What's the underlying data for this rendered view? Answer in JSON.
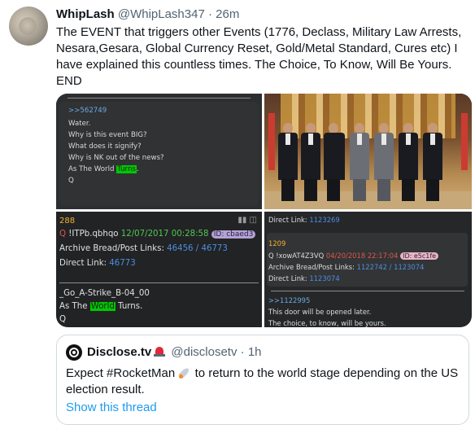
{
  "tweet": {
    "author_name": "WhipLash",
    "author_handle": "@WhipLash347",
    "separator": "·",
    "time": "26m",
    "text_lines": [
      "The EVENT that triggers other Events (1776, Declass, Military Law Arrests,",
      "Nesara,Gesara, Global Currency Reset, Gold/Metal Standard, Cures etc) I",
      "have explained this countless times. The Choice, To Know, Will Be Yours.",
      "END"
    ]
  },
  "media": {
    "panel1": {
      "ref": ">>562749",
      "lines": [
        "Water.",
        "Why is this event BIG?",
        "What does it signify?",
        "Why is NK out of the news?"
      ],
      "last_prefix": "As The World ",
      "last_highlight": "Turns",
      "last_suffix": ".",
      "sign": "Q"
    },
    "panel3": {
      "number": "288",
      "q": "Q",
      "trip": "!ITPb.qbhqo",
      "date": "12/07/2017 00:28:58",
      "id": "ID: cbaed3",
      "archive_label": "Archive Bread/Post Links:",
      "archive_link1": "46456",
      "archive_slash": "/",
      "archive_link2": "46773",
      "direct_label": "Direct Link:",
      "direct_link": "46773",
      "strike": "_Go_A-Strike_B-04_00",
      "as_the": "As The",
      "world": "World",
      "turns": "Turns.",
      "sign": "Q"
    },
    "panel4": {
      "top_label": "Direct Link:",
      "top_link": "1123269",
      "number": "1209",
      "q": "Q",
      "trip": "!xowAT4Z3VQ",
      "date": "04/20/2018 22:17:04",
      "id": "ID: e5c1fe",
      "archive_label": "Archive Bread/Post Links:",
      "archive_link1": "1122742",
      "archive_slash": "/",
      "archive_link2": "1123074",
      "direct_label": "Direct Link:",
      "direct_link": "1123074",
      "ref": ">>1122995",
      "line1": "This door will be opened later.",
      "line2": "The choice, to know, will be yours."
    }
  },
  "quote": {
    "name": "Disclose.tv",
    "handle": "@disclosetv",
    "separator": "·",
    "time": "1h",
    "text_part1": "Expect #RocketMan",
    "text_part2": " to return to the world stage depending on the US",
    "text_line2": "election result.",
    "show_thread": "Show this thread"
  },
  "colors": {
    "link_blue": "#1d9bf0",
    "meta_grey": "#536471",
    "highlight_green": "#00c800"
  }
}
